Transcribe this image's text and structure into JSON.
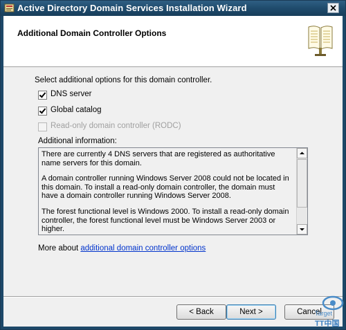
{
  "window": {
    "title": "Active Directory Domain Services Installation Wizard"
  },
  "header": {
    "title": "Additional Domain Controller Options"
  },
  "main": {
    "intro": "Select additional options for this domain controller.",
    "options": [
      {
        "label": "DNS server",
        "checked": true,
        "enabled": true
      },
      {
        "label": "Global catalog",
        "checked": true,
        "enabled": true
      },
      {
        "label": "Read-only domain controller (RODC)",
        "checked": false,
        "enabled": false
      }
    ],
    "info_label": "Additional information:",
    "info_paragraphs": [
      "There are currently 4 DNS servers that are registered as authoritative name servers for this domain.",
      "A domain controller running Windows Server 2008 could not be located in this domain. To install a read-only domain controller, the domain must have a domain controller running Windows Server 2008.",
      "The forest functional level is Windows 2000. To install a read-only domain controller, the forest functional level must be Windows Server 2003 or higher."
    ],
    "more_prefix": "More about ",
    "more_link": "additional domain controller options"
  },
  "footer": {
    "back_label": "< Back",
    "next_label": "Next >",
    "cancel_label": "Cancel"
  },
  "watermark": {
    "text_top": "Target",
    "text_bottom": "TT中国"
  },
  "icons": {
    "app": "ad-wizard-icon",
    "close": "close-icon",
    "header": "book-icon",
    "scroll_up": "scroll-up-icon",
    "scroll_down": "scroll-down-icon"
  },
  "colors": {
    "titlebar": "#1f4b6c",
    "link": "#0033cc",
    "dialog_bg": "#f0f0f0"
  }
}
